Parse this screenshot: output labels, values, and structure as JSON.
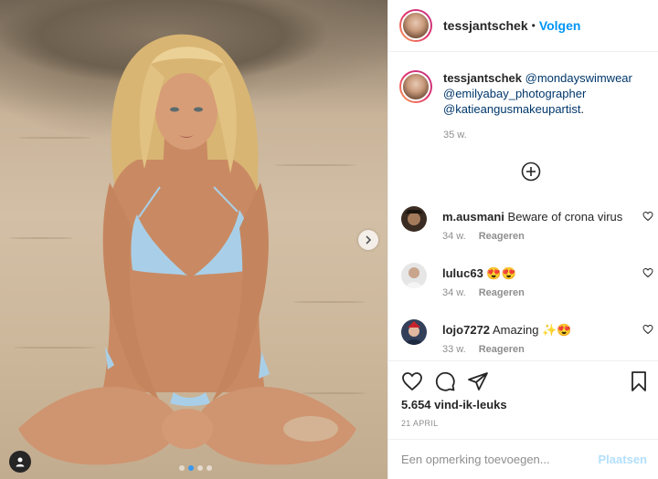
{
  "post": {
    "username": "tessjantschek",
    "follow_label": "Volgen",
    "separator": "•"
  },
  "caption": {
    "username": "tessjantschek",
    "mentions": [
      "@mondayswimwear",
      "@emilyabay_photographer",
      "@katieangusmakeupartist"
    ],
    "trailing": ".",
    "time": "35 w."
  },
  "comments": [
    {
      "username": "m.ausmani",
      "text": "Beware of crona virus",
      "time": "34 w.",
      "reply": "Reageren"
    },
    {
      "username": "luluc63",
      "text": "😍😍",
      "time": "34 w.",
      "reply": "Reageren"
    },
    {
      "username": "lojo7272",
      "text": "Amazing ✨😍",
      "time": "33 w.",
      "reply": "Reageren"
    }
  ],
  "stats": {
    "likes": "5.654 vind-ik-leuks",
    "date": "21 APRIL"
  },
  "comment_box": {
    "placeholder": "Een opmerking toevoegen...",
    "post_label": "Plaatsen"
  },
  "icons": {
    "like": "heart-icon",
    "comment": "comment-icon",
    "share": "share-icon",
    "save": "bookmark-icon",
    "more_comments": "plus-circle-icon",
    "next": "chevron-right-icon",
    "tag": "user-icon"
  },
  "colors": {
    "link": "#0095f6",
    "mention": "#00376b",
    "post_disabled": "#b2dffc",
    "muted": "#8e8e8e",
    "carousel_active": "#3897f0"
  },
  "carousel": {
    "count": 4,
    "active": 1
  }
}
